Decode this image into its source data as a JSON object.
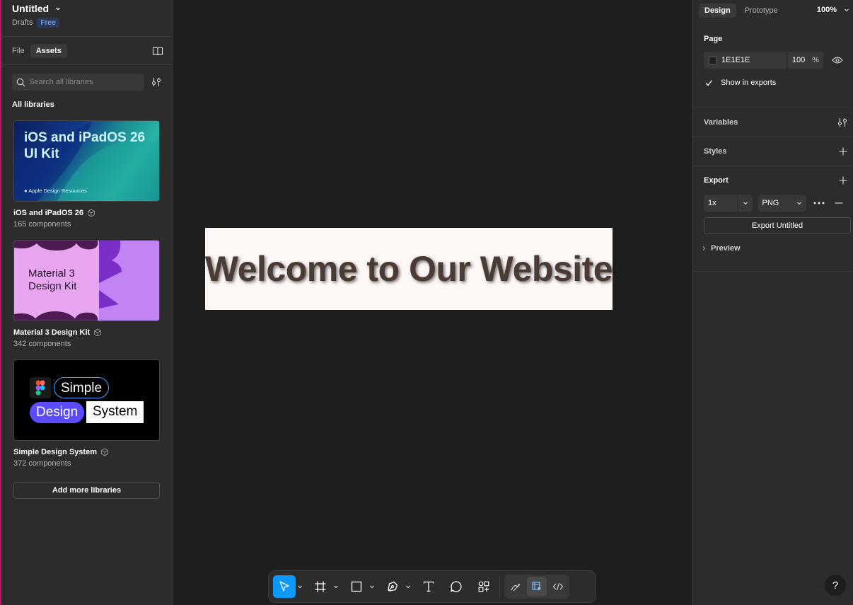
{
  "file": {
    "title": "Untitled",
    "location": "Drafts",
    "plan_badge": "Free"
  },
  "left_tabs": [
    "File",
    "Assets"
  ],
  "active_left_tab": "Assets",
  "search": {
    "placeholder": "Search all libraries"
  },
  "libraries_heading": "All libraries",
  "libraries": [
    {
      "name": "iOS and iPadOS 26",
      "count": "165 components",
      "thumb_title_1": "iOS and iPadOS 26",
      "thumb_title_2": "UI Kit",
      "thumb_footer": "Apple Design Resources"
    },
    {
      "name": "Material 3 Design Kit",
      "count": "342 components",
      "thumb_title_1": "Material 3",
      "thumb_title_2": "Design Kit"
    },
    {
      "name": "Simple Design System",
      "count": "372 components",
      "thumb_word_1": "Simple",
      "thumb_word_2": "Design",
      "thumb_word_3": "System"
    }
  ],
  "add_libraries_label": "Add more libraries",
  "canvas": {
    "frame_text": "Welcome to Our Website"
  },
  "toolbar": {
    "active_tool": "move",
    "tools": [
      "move-tool",
      "frame-tool",
      "rectangle-tool",
      "pen-tool",
      "text-tool",
      "comment-tool",
      "actions-tool"
    ],
    "modes": [
      "draw-mode",
      "design-mode",
      "dev-mode"
    ],
    "active_mode": "design-mode"
  },
  "right_panel": {
    "tabs": [
      "Design",
      "Prototype"
    ],
    "active_tab": "Design",
    "zoom": "100%",
    "page": {
      "heading": "Page",
      "fill_hex": "1E1E1E",
      "fill_opacity": "100",
      "opacity_unit": "%",
      "show_in_exports_label": "Show in exports",
      "show_in_exports": true
    },
    "variables_label": "Variables",
    "styles_label": "Styles",
    "export": {
      "heading": "Export",
      "scale": "1x",
      "format": "PNG",
      "button_label": "Export Untitled",
      "preview_label": "Preview"
    },
    "help_label": "?"
  },
  "colors": {
    "accent": "#0d99ff",
    "canvas_bg": "#1e1e1e",
    "panel_bg": "#2c2c2c",
    "frame_bg": "#fdf7f5"
  }
}
